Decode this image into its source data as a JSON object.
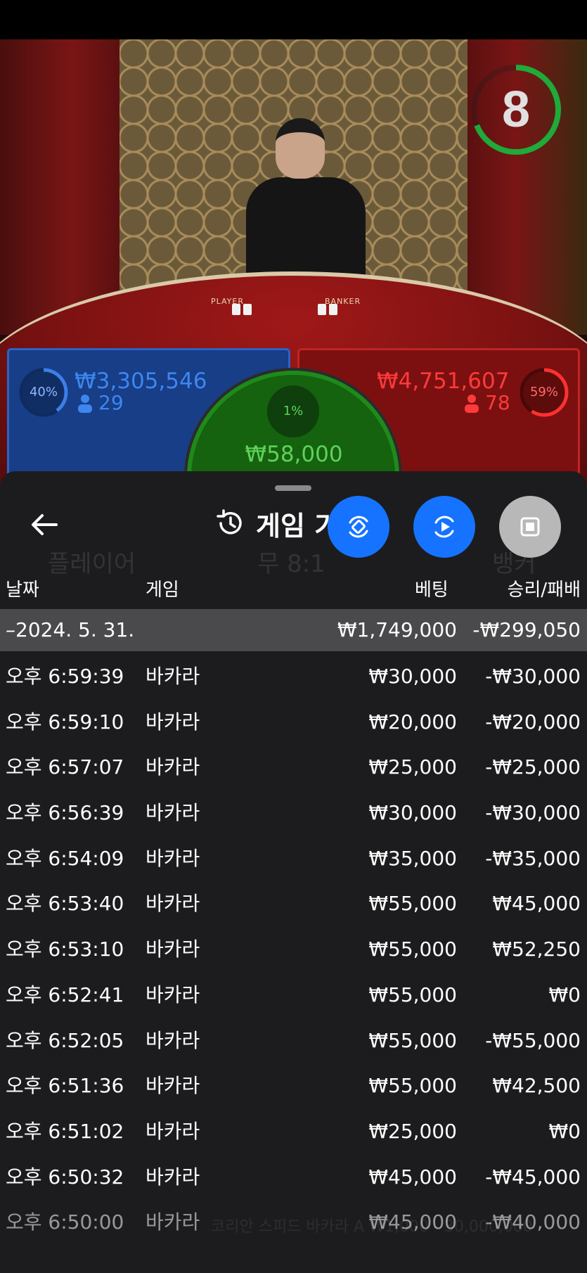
{
  "countdown": "8",
  "player_bets": {
    "percent": "40%",
    "amount": "₩3,305,546",
    "players": "29"
  },
  "banker_bets": {
    "percent": "59%",
    "amount": "₩4,751,607",
    "players": "78"
  },
  "tie_bets": {
    "percent": "1%",
    "amount": "₩58,000"
  },
  "colors": {
    "player": "#2c63c6",
    "banker": "#c02424",
    "tie": "#1e8a1a",
    "accent_blue": "#1673ff"
  },
  "header": {
    "title": "게임 기"
  },
  "columns": {
    "date": "날짜",
    "game": "게임",
    "bet": "베팅",
    "result": "승리/패배"
  },
  "day_summary": {
    "date": "–2024. 5. 31.",
    "bet": "₩1,749,000",
    "result": "-₩299,050"
  },
  "rows": [
    {
      "time": "오후 6:59:39",
      "game": "바카라",
      "bet": "₩30,000",
      "result": "-₩30,000"
    },
    {
      "time": "오후 6:59:10",
      "game": "바카라",
      "bet": "₩20,000",
      "result": "-₩20,000"
    },
    {
      "time": "오후 6:57:07",
      "game": "바카라",
      "bet": "₩25,000",
      "result": "-₩25,000"
    },
    {
      "time": "오후 6:56:39",
      "game": "바카라",
      "bet": "₩30,000",
      "result": "-₩30,000"
    },
    {
      "time": "오후 6:54:09",
      "game": "바카라",
      "bet": "₩35,000",
      "result": "-₩35,000"
    },
    {
      "time": "오후 6:53:40",
      "game": "바카라",
      "bet": "₩55,000",
      "result": "₩45,000"
    },
    {
      "time": "오후 6:53:10",
      "game": "바카라",
      "bet": "₩55,000",
      "result": "₩52,250"
    },
    {
      "time": "오후 6:52:41",
      "game": "바카라",
      "bet": "₩55,000",
      "result": "₩0"
    },
    {
      "time": "오후 6:52:05",
      "game": "바카라",
      "bet": "₩55,000",
      "result": "-₩55,000"
    },
    {
      "time": "오후 6:51:36",
      "game": "바카라",
      "bet": "₩55,000",
      "result": "₩42,500"
    },
    {
      "time": "오후 6:51:02",
      "game": "바카라",
      "bet": "₩25,000",
      "result": "₩0"
    },
    {
      "time": "오후 6:50:32",
      "game": "바카라",
      "bet": "₩45,000",
      "result": "-₩45,000"
    },
    {
      "time": "오후 6:50:00",
      "game": "바카라",
      "bet": "₩45,000",
      "result": "-₩40,000"
    }
  ],
  "background": {
    "player_label": "플레이어",
    "tie_label": "무 8:1",
    "banker_label": "뱅커",
    "footer_text": "코리안 스피드 바카라 A ₩1,000 - 30,000,000"
  },
  "table_felt": {
    "player": "PLAYER",
    "banker": "BANKER"
  },
  "icons": {
    "back": "arrow-left-icon",
    "history": "history-icon",
    "rotate": "rotate-icon",
    "replay": "replay-icon",
    "stop": "stop-icon"
  }
}
